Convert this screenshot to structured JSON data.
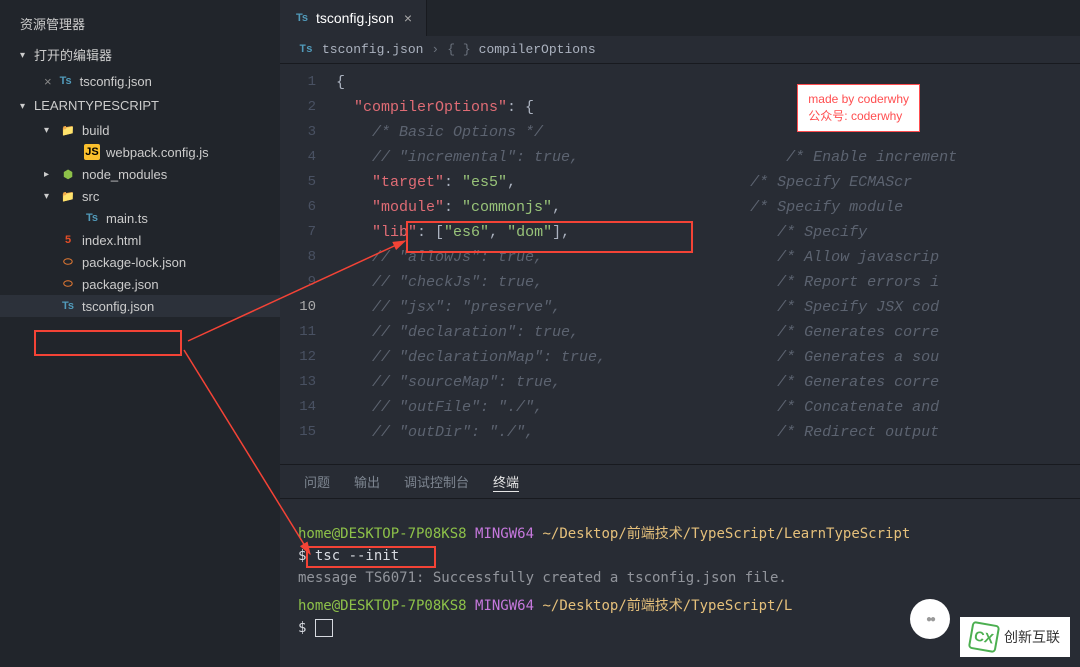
{
  "sidebar": {
    "explorer_title": "资源管理器",
    "open_editors_title": "打开的编辑器",
    "open_editors": [
      {
        "icon": "ts",
        "label": "tsconfig.json"
      }
    ],
    "project_name": "LEARNTYPESCRIPT",
    "tree": [
      {
        "depth": 2,
        "chevron": "down",
        "icon": "folder",
        "label": "build"
      },
      {
        "depth": 3,
        "chevron": "",
        "icon": "js",
        "label": "webpack.config.js"
      },
      {
        "depth": 2,
        "chevron": "right",
        "icon": "nodemod",
        "label": "node_modules"
      },
      {
        "depth": 2,
        "chevron": "down",
        "icon": "folder",
        "label": "src"
      },
      {
        "depth": 3,
        "chevron": "",
        "icon": "ts",
        "label": "main.ts"
      },
      {
        "depth": 2,
        "chevron": "",
        "icon": "html",
        "label": "index.html"
      },
      {
        "depth": 2,
        "chevron": "",
        "icon": "json",
        "label": "package-lock.json"
      },
      {
        "depth": 2,
        "chevron": "",
        "icon": "json",
        "label": "package.json"
      },
      {
        "depth": 2,
        "chevron": "",
        "icon": "ts",
        "label": "tsconfig.json",
        "active": true
      }
    ]
  },
  "tab": {
    "icon": "ts",
    "label": "tsconfig.json",
    "close": "×"
  },
  "breadcrumb": {
    "file_icon": "ts",
    "file": "tsconfig.json",
    "sep": "›",
    "braces": "{ }",
    "symbol": "compilerOptions"
  },
  "editor": {
    "filename": "tsconfig.json",
    "lines": [
      {
        "n": 1,
        "tokens": [
          {
            "cls": "tok-punc",
            "t": "{"
          }
        ]
      },
      {
        "n": 2,
        "tokens": [
          {
            "cls": "",
            "t": "  "
          },
          {
            "cls": "tok-key",
            "t": "\"compilerOptions\""
          },
          {
            "cls": "tok-punc",
            "t": ": {"
          }
        ]
      },
      {
        "n": 3,
        "tokens": [
          {
            "cls": "",
            "t": "    "
          },
          {
            "cls": "tok-cmt",
            "t": "/* Basic Options */"
          }
        ]
      },
      {
        "n": 4,
        "tokens": [
          {
            "cls": "",
            "t": "    "
          },
          {
            "cls": "tok-cmt",
            "t": "// \"incremental\": true,                       /* Enable increment"
          }
        ]
      },
      {
        "n": 5,
        "tokens": [
          {
            "cls": "",
            "t": "    "
          },
          {
            "cls": "tok-key",
            "t": "\"target\""
          },
          {
            "cls": "tok-punc",
            "t": ": "
          },
          {
            "cls": "tok-str",
            "t": "\"es5\""
          },
          {
            "cls": "tok-punc",
            "t": ","
          },
          {
            "cls": "",
            "t": "                          "
          },
          {
            "cls": "tok-cmt",
            "t": "/* Specify ECMAScr"
          }
        ]
      },
      {
        "n": 6,
        "tokens": [
          {
            "cls": "",
            "t": "    "
          },
          {
            "cls": "tok-key",
            "t": "\"module\""
          },
          {
            "cls": "tok-punc",
            "t": ": "
          },
          {
            "cls": "tok-str",
            "t": "\"commonjs\""
          },
          {
            "cls": "tok-punc",
            "t": ","
          },
          {
            "cls": "",
            "t": "                     "
          },
          {
            "cls": "tok-cmt",
            "t": "/* Specify module "
          }
        ]
      },
      {
        "n": 7,
        "tokens": [
          {
            "cls": "",
            "t": "    "
          },
          {
            "cls": "tok-key",
            "t": "\"lib\""
          },
          {
            "cls": "tok-punc",
            "t": ": ["
          },
          {
            "cls": "tok-str",
            "t": "\"es6\""
          },
          {
            "cls": "tok-punc",
            "t": ", "
          },
          {
            "cls": "tok-str",
            "t": "\"dom\""
          },
          {
            "cls": "tok-punc",
            "t": "],"
          },
          {
            "cls": "",
            "t": "                       "
          },
          {
            "cls": "tok-cmt",
            "t": "/* Specify"
          }
        ]
      },
      {
        "n": 8,
        "tokens": [
          {
            "cls": "",
            "t": "    "
          },
          {
            "cls": "tok-cmt",
            "t": "// \"allowJs\": true,                          /* Allow javascrip"
          }
        ]
      },
      {
        "n": 9,
        "tokens": [
          {
            "cls": "",
            "t": "    "
          },
          {
            "cls": "tok-cmt",
            "t": "// \"checkJs\": true,                          /* Report errors i"
          }
        ]
      },
      {
        "n": 10,
        "tokens": [
          {
            "cls": "",
            "t": "    "
          },
          {
            "cls": "tok-cmt",
            "t": "// \"jsx\": \"preserve\",                        /* Specify JSX cod"
          }
        ]
      },
      {
        "n": 11,
        "tokens": [
          {
            "cls": "",
            "t": "    "
          },
          {
            "cls": "tok-cmt",
            "t": "// \"declaration\": true,                      /* Generates corre"
          }
        ]
      },
      {
        "n": 12,
        "tokens": [
          {
            "cls": "",
            "t": "    "
          },
          {
            "cls": "tok-cmt",
            "t": "// \"declarationMap\": true,                   /* Generates a sou"
          }
        ]
      },
      {
        "n": 13,
        "tokens": [
          {
            "cls": "",
            "t": "    "
          },
          {
            "cls": "tok-cmt",
            "t": "// \"sourceMap\": true,                        /* Generates corre"
          }
        ]
      },
      {
        "n": 14,
        "tokens": [
          {
            "cls": "",
            "t": "    "
          },
          {
            "cls": "tok-cmt",
            "t": "// \"outFile\": \"./\",                          /* Concatenate and"
          }
        ]
      },
      {
        "n": 15,
        "tokens": [
          {
            "cls": "",
            "t": "    "
          },
          {
            "cls": "tok-cmt",
            "t": "// \"outDir\": \"./\",                           /* Redirect output"
          }
        ]
      }
    ]
  },
  "note": {
    "line1": "made by coderwhy",
    "line2": "公众号: coderwhy"
  },
  "panel": {
    "tabs": {
      "t1": "问题",
      "t2": "输出",
      "t3": "调试控制台",
      "t4": "终端"
    }
  },
  "terminal": {
    "prompt1_user": "home@DESKTOP-7P08KS8",
    "prompt1_sys": "MINGW64",
    "prompt1_path": "~/Desktop/前端技术/TypeScript/LearnTypeScript",
    "line1_cmd": "$ tsc --init",
    "line2_msg": "message TS6071: Successfully created a tsconfig.json file.",
    "prompt2_user": "home@DESKTOP-7P08KS8",
    "prompt2_sys": "MINGW64",
    "prompt2_path": "~/Desktop/前端技术/TypeScript/L",
    "line3_cmd": "$ "
  },
  "watermark": {
    "text": "创新互联",
    "logo": "CX"
  }
}
